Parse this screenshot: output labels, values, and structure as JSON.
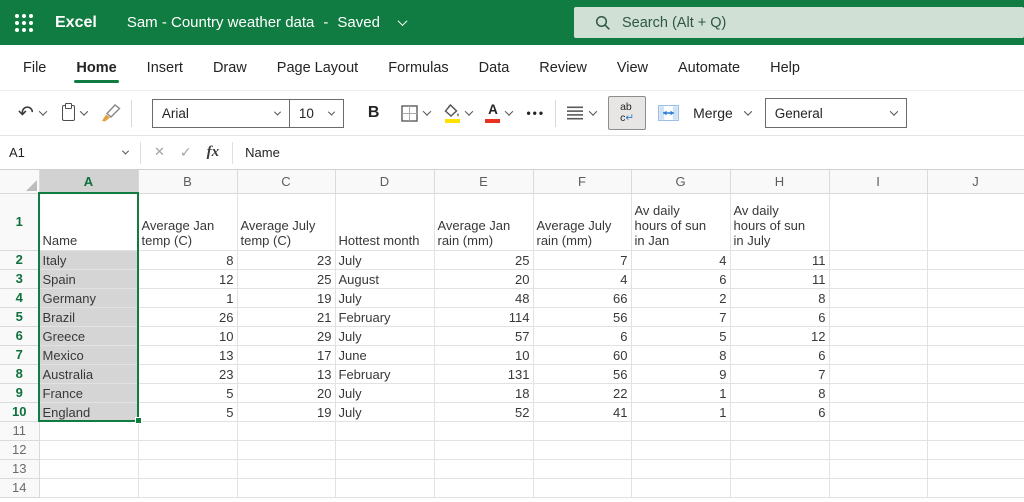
{
  "colors": {
    "brand_green": "#107C41",
    "selection_green": "#0E703C",
    "search_bg": "#D0E0D5",
    "search_text": "#2F5741",
    "selection_fill": "#D5D5D5",
    "selected_header_bg": "#D2D2D2",
    "fill_yellow": "#FFE100",
    "font_red": "#E8321F",
    "merge_blue": "#2B7CD3"
  },
  "topbar": {
    "app_name": "Excel",
    "document_title": "Sam - Country weather data",
    "status_separator": "-",
    "save_status": "Saved",
    "search_placeholder": "Search (Alt + Q)"
  },
  "menu": {
    "items": [
      "File",
      "Home",
      "Insert",
      "Draw",
      "Page Layout",
      "Formulas",
      "Data",
      "Review",
      "View",
      "Automate",
      "Help"
    ],
    "active_item": "Home"
  },
  "toolbar": {
    "undo_glyph": "↶",
    "font_name": "Arial",
    "font_size": "10",
    "bold_label": "B",
    "font_color_letter": "A",
    "ellipsis": "•••",
    "wrap_line1": "ab",
    "wrap_line2": "c",
    "wrap_arrow": "↵",
    "merge_label": "Merge",
    "number_format": "General"
  },
  "formula_bar": {
    "name_box": "A1",
    "cancel_glyph": "✕",
    "confirm_glyph": "✓",
    "fx_label": "fx",
    "content": "Name"
  },
  "sheet": {
    "column_letters": [
      "A",
      "B",
      "C",
      "D",
      "E",
      "F",
      "G",
      "H",
      "I",
      "J"
    ],
    "selected_column": "A",
    "selected_rows": [
      1,
      10
    ],
    "row_count": 14,
    "active_cell": "A1",
    "header_row": [
      "Name",
      "Average Jan\ntemp (C)",
      "Average July\ntemp (C)",
      "Hottest month",
      "Average Jan\nrain (mm)",
      "Average July\nrain (mm)",
      "Av daily\nhours of sun\nin Jan",
      "Av daily\nhours of sun\nin July"
    ],
    "rows": [
      [
        "Italy",
        8,
        23,
        "July",
        25,
        7,
        4,
        11
      ],
      [
        "Spain",
        12,
        25,
        "August",
        20,
        4,
        6,
        11
      ],
      [
        "Germany",
        1,
        19,
        "July",
        48,
        66,
        2,
        8
      ],
      [
        "Brazil",
        26,
        21,
        "February",
        114,
        56,
        7,
        6
      ],
      [
        "Greece",
        10,
        29,
        "July",
        57,
        6,
        5,
        12
      ],
      [
        "Mexico",
        13,
        17,
        "June",
        10,
        60,
        8,
        6
      ],
      [
        "Australia",
        23,
        13,
        "February",
        131,
        56,
        9,
        7
      ],
      [
        "France",
        5,
        20,
        "July",
        18,
        22,
        1,
        8
      ],
      [
        "England",
        5,
        19,
        "July",
        52,
        41,
        1,
        6
      ]
    ],
    "column_alignments": [
      "txt",
      "num",
      "num",
      "txt",
      "num",
      "num",
      "num",
      "num"
    ]
  }
}
